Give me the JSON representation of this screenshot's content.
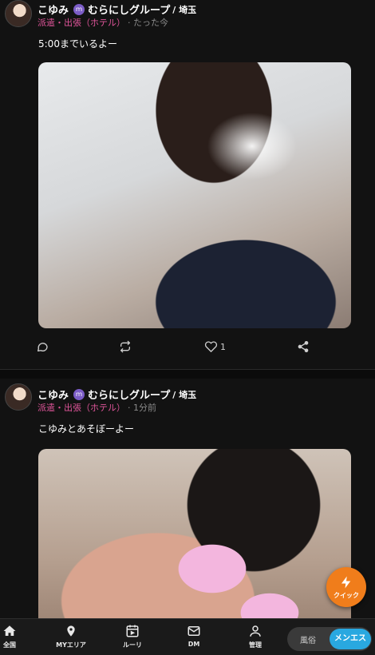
{
  "posts": [
    {
      "name": "こゆみ",
      "group_badge": "ｍ",
      "group": "むらにしグループ",
      "area": "/ 埼玉",
      "category": "派遣・出張（ホテル）",
      "time": "· たった今",
      "message": "5:00までいるよー",
      "like_count": "1"
    },
    {
      "name": "こゆみ",
      "group_badge": "ｍ",
      "group": "むらにしグループ",
      "area": "/ 埼玉",
      "category": "派遣・出張（ホテル）",
      "time": "· 1分前",
      "message": "こゆみとあそぼーよー"
    }
  ],
  "quick_button": {
    "label": "クイック",
    "color": "#f07d1b"
  },
  "bottom_nav": {
    "items": [
      {
        "label": "全国",
        "icon": "home-icon"
      },
      {
        "label": "MYエリア",
        "icon": "map-pin-icon"
      },
      {
        "label": "ルーリ",
        "icon": "calendar-icon"
      },
      {
        "label": "DM",
        "icon": "mail-icon"
      },
      {
        "label": "管理",
        "icon": "person-icon"
      }
    ],
    "segment": {
      "option_1": "風俗",
      "option_2": "メンエス",
      "selected": "メンエス"
    }
  },
  "colors": {
    "background": "#121212",
    "category": "#e0559a",
    "accent_blue": "#29a8e0"
  }
}
